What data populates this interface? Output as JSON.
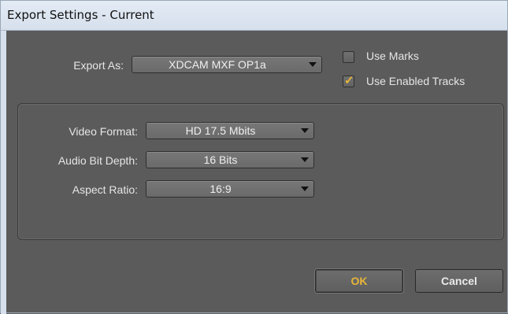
{
  "window": {
    "title": "Export Settings - Current"
  },
  "export_as": {
    "label": "Export As:",
    "value": "XDCAM MXF OP1a"
  },
  "options": {
    "use_marks": {
      "label": "Use Marks",
      "checked": false
    },
    "use_enabled_tracks": {
      "label": "Use Enabled Tracks",
      "checked": true
    }
  },
  "format": {
    "video_format": {
      "label": "Video Format:",
      "value": "HD 17.5 Mbits"
    },
    "audio_bit_depth": {
      "label": "Audio Bit Depth:",
      "value": "16 Bits"
    },
    "aspect_ratio": {
      "label": "Aspect Ratio:",
      "value": "16:9"
    }
  },
  "buttons": {
    "ok": "OK",
    "cancel": "Cancel"
  },
  "colors": {
    "accent": "#e8b53a",
    "dialog_bg": "#5b5b5b",
    "titlebar": "#d6e0ec"
  },
  "icons": {
    "checkmark": "check-icon",
    "dropdown_arrow": "chevron-down-icon"
  }
}
